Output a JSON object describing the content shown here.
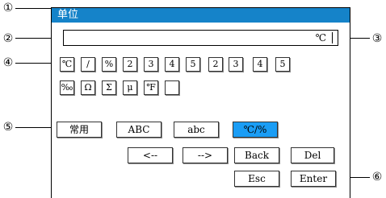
{
  "title": "单位",
  "field": {
    "value": "℃"
  },
  "symbols_row1": [
    "℃",
    "/",
    "%",
    "2",
    "3",
    "4",
    "5",
    "2",
    "3",
    "4",
    "5"
  ],
  "symbols_row2": [
    "‰",
    "Ω",
    "Σ",
    "μ",
    "℉",
    ""
  ],
  "mode_buttons": [
    {
      "label": "常用",
      "selected": false
    },
    {
      "label": "ABC",
      "selected": false
    },
    {
      "label": "abc",
      "selected": false
    },
    {
      "label": "℃/%",
      "selected": true
    }
  ],
  "nav": {
    "left": "<--",
    "right": "-->",
    "back": "Back",
    "del": "Del"
  },
  "actions": {
    "esc": "Esc",
    "enter": "Enter"
  },
  "callouts": {
    "c1": "①",
    "c2": "②",
    "c3": "③",
    "c4": "④",
    "c5": "⑤",
    "c6": "⑥"
  },
  "colors": {
    "titlebar": "#1583c9",
    "selected": "#1a9df5"
  }
}
